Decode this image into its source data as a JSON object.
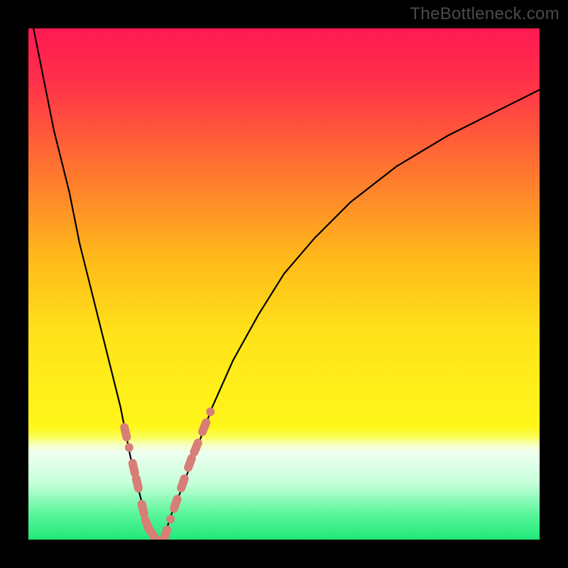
{
  "watermark": "TheBottleneck.com",
  "gradient": {
    "stops": [
      {
        "offset": "0%",
        "color": "#ff1a53"
      },
      {
        "offset": "10%",
        "color": "#ff2f4a"
      },
      {
        "offset": "25%",
        "color": "#ff6a33"
      },
      {
        "offset": "45%",
        "color": "#ffb91a"
      },
      {
        "offset": "60%",
        "color": "#ffe31a"
      },
      {
        "offset": "78%",
        "color": "#fff61a"
      },
      {
        "offset": "80%",
        "color": "#fbff5c"
      },
      {
        "offset": "81%",
        "color": "#f7ffa6"
      },
      {
        "offset": "82%",
        "color": "#f4ffd6"
      },
      {
        "offset": "83%",
        "color": "#eefff0"
      },
      {
        "offset": "89%",
        "color": "#c6ffda"
      },
      {
        "offset": "95%",
        "color": "#59f59a"
      },
      {
        "offset": "100%",
        "color": "#22e879"
      }
    ]
  },
  "chart_data": {
    "type": "line",
    "title": "",
    "xlabel": "",
    "ylabel": "",
    "xlim": [
      0,
      100
    ],
    "ylim": [
      0,
      100
    ],
    "series": [
      {
        "name": "bottleneck-curve",
        "x": [
          1,
          3,
          5,
          8,
          10,
          13,
          15,
          18,
          20,
          22,
          23,
          24,
          25,
          26,
          27,
          28,
          30,
          33,
          36,
          40,
          45,
          50,
          56,
          63,
          72,
          82,
          92,
          100
        ],
        "y": [
          100,
          90,
          80,
          68,
          58,
          46,
          38,
          26,
          16,
          8,
          5,
          2,
          0,
          0,
          2,
          5,
          10,
          18,
          26,
          35,
          44,
          52,
          59,
          66,
          73,
          79,
          84,
          88
        ]
      }
    ],
    "markers": {
      "name": "uncertainty-beads",
      "left_branch": [
        {
          "x": 19.0,
          "y": 21
        },
        {
          "x": 19.7,
          "y": 18
        },
        {
          "x": 20.6,
          "y": 14
        },
        {
          "x": 21.3,
          "y": 11
        },
        {
          "x": 22.4,
          "y": 6
        },
        {
          "x": 23.2,
          "y": 3
        },
        {
          "x": 24.3,
          "y": 1
        },
        {
          "x": 25.0,
          "y": 0
        }
      ],
      "right_branch": [
        {
          "x": 26.8,
          "y": 1
        },
        {
          "x": 27.8,
          "y": 4
        },
        {
          "x": 28.8,
          "y": 7
        },
        {
          "x": 30.2,
          "y": 11
        },
        {
          "x": 31.6,
          "y": 15
        },
        {
          "x": 32.8,
          "y": 18
        },
        {
          "x": 34.4,
          "y": 22
        },
        {
          "x": 35.6,
          "y": 25
        }
      ]
    }
  }
}
